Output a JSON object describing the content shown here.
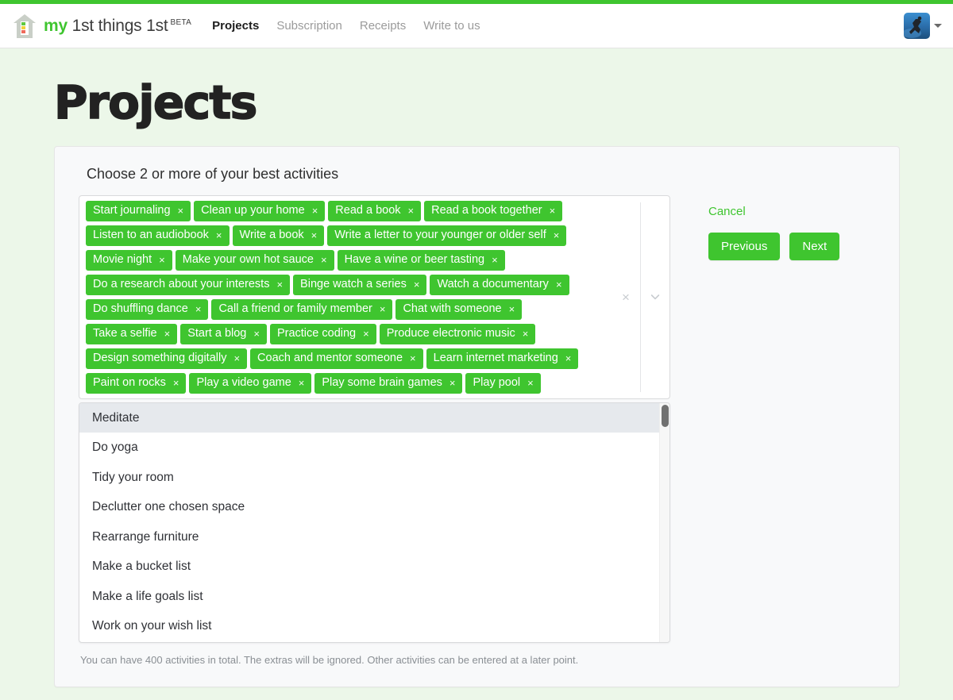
{
  "theme": {
    "brand_green": "#3fc52f",
    "page_bg": "#ecf7e9",
    "card_bg": "#f8f9fa",
    "tag_green": "#3fc52f",
    "focused_option_bg": "#e6e9ed"
  },
  "navbar": {
    "logo_icon": "house-logo-icon",
    "brand_my": "my",
    "brand_rest": "1st things 1st",
    "brand_beta": "BETA",
    "links": [
      {
        "label": "Projects",
        "active": true
      },
      {
        "label": "Subscription",
        "active": false
      },
      {
        "label": "Receipts",
        "active": false
      },
      {
        "label": "Write to us",
        "active": false
      }
    ],
    "avatar_icon": "user-avatar-photo",
    "caret_icon": "caret-down-icon"
  },
  "page": {
    "title": "Projects"
  },
  "card": {
    "label": "Choose 2 or more of your best activities",
    "hint": "You can have 400 activities in total. The extras will be ignored. Other activities can be entered at a later point."
  },
  "multiselect": {
    "clear_icon": "clear-all-icon",
    "clear_glyph": "×",
    "dropdown_icon": "chevron-down-icon",
    "remove_glyph": "×",
    "selected": [
      "Start journaling",
      "Clean up your home",
      "Read a book",
      "Read a book together",
      "Listen to an audiobook",
      "Write a book",
      "Write a letter to your younger or older self",
      "Movie night",
      "Make your own hot sauce",
      "Have a wine or beer tasting",
      "Do a research about your interests",
      "Binge watch a series",
      "Watch a documentary",
      "Do shuffling dance",
      "Call a friend or family member",
      "Chat with someone",
      "Take a selfie",
      "Start a blog",
      "Practice coding",
      "Produce electronic music",
      "Design something digitally",
      "Coach and mentor someone",
      "Learn internet marketing",
      "Paint on rocks",
      "Play a video game",
      "Play some brain games",
      "Play pool"
    ],
    "options": [
      {
        "label": "Meditate",
        "focused": true
      },
      {
        "label": "Do yoga",
        "focused": false
      },
      {
        "label": "Tidy your room",
        "focused": false
      },
      {
        "label": "Declutter one chosen space",
        "focused": false
      },
      {
        "label": "Rearrange furniture",
        "focused": false
      },
      {
        "label": "Make a bucket list",
        "focused": false
      },
      {
        "label": "Make a life goals list",
        "focused": false
      },
      {
        "label": "Work on your wish list",
        "focused": false
      }
    ]
  },
  "actions": {
    "cancel_label": "Cancel",
    "previous_label": "Previous",
    "next_label": "Next"
  }
}
